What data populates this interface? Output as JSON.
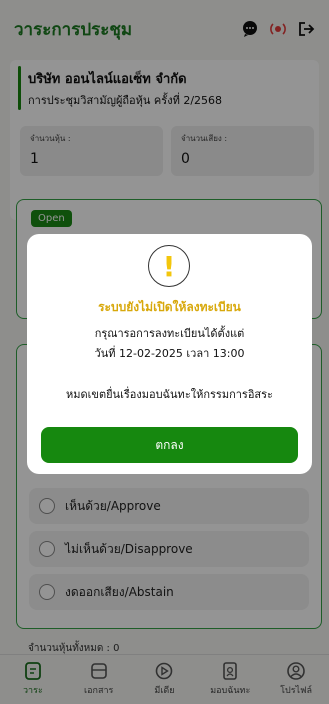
{
  "header": {
    "title": "วาระการประชุม",
    "accent_color": "#1d7a22"
  },
  "company": {
    "name": "บริษัท ออนไลน์แอเซ็ท จำกัด",
    "meeting": "การประชุมวิสามัญผู้ถือหุ้น ครั้งที่ 2/2568",
    "shares_label": "จำนวนหุ้น :",
    "shares_value": "1",
    "votes_label": "จำนวนเสียง :",
    "votes_value": "0"
  },
  "agenda_card": {
    "badge": "Open"
  },
  "vote_options": [
    {
      "label": "เห็นด้วย/Approve"
    },
    {
      "label": "ไม่เห็นด้วย/Disapprove"
    },
    {
      "label": "งดออกเสียง/Abstain"
    }
  ],
  "total_shares": "จำนวนหุ้นทั้งหมด : 0",
  "bottom_nav": [
    {
      "label": "วาระ",
      "icon": "agenda-icon",
      "active": true
    },
    {
      "label": "เอกสาร",
      "icon": "document-icon",
      "active": false
    },
    {
      "label": "มีเดีย",
      "icon": "media-play-icon",
      "active": false
    },
    {
      "label": "มอบฉันทะ",
      "icon": "proxy-icon",
      "active": false
    },
    {
      "label": "โปรไฟล์",
      "icon": "profile-icon",
      "active": false
    }
  ],
  "modal": {
    "title": "ระบบยังไม่เปิดให้ลงทะเบียน",
    "line1": "กรุณารอการลงทะเบียนได้ตั้งแต่",
    "line2": "วันที่ 12-02-2025 เวลา 13:00",
    "line3": "หมดเขตยื่นเรื่องมอบฉันทะให้กรรมการอิสระ",
    "ok_label": "ตกลง",
    "title_color": "#d8a80b",
    "button_color": "#16880f"
  }
}
